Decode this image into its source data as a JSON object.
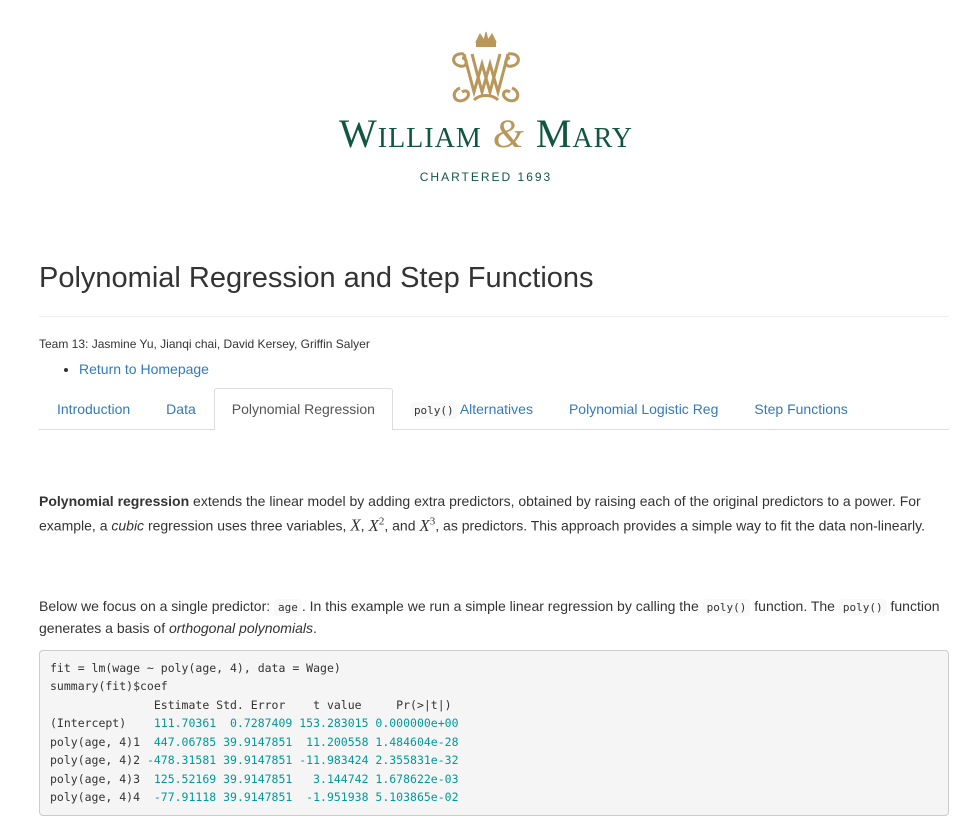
{
  "logo": {
    "name_left": "William",
    "ampersand": "&",
    "name_right": "Mary",
    "tagline": "CHARTERED 1693"
  },
  "page": {
    "title": "Polynomial Regression and Step Functions",
    "authors": "Team 13: Jasmine Yu, Jianqi chai, David Kersey, Griffin Salyer",
    "links": [
      "Return to Homepage"
    ]
  },
  "tabs": {
    "introduction": "Introduction",
    "data": "Data",
    "polynomial_regression": "Polynomial Regression",
    "poly_code": "poly()",
    "poly_alternatives": "Alternatives",
    "polynomial_logistic": "Polynomial Logistic Reg",
    "step_functions": "Step Functions"
  },
  "paragraph1": {
    "bold": "Polynomial regression",
    "t1": " extends the linear model by adding extra predictors, obtained by raising each of the original predictors to a power. For example, a ",
    "em": "cubic",
    "t2": " regression uses three variables, ",
    "m1": "X",
    "sep1": ", ",
    "m2": "X",
    "m2sup": "2",
    "sep2": ", and ",
    "m3": "X",
    "m3sup": "3",
    "t3": ", as predictors. This approach provides a simple way to fit the data non-linearly."
  },
  "paragraph2": {
    "t1": "Below we focus on a single predictor: ",
    "c1": "age",
    "t2": ". In this example we run a simple linear regression by calling the ",
    "c2": "poly()",
    "t3": " function. The ",
    "c3": "poly()",
    "t4": " function generates a basis of ",
    "em": "orthogonal polynomials",
    "t5": "."
  },
  "code": {
    "lines": [
      "fit = lm(wage ~ poly(age, 4), data = Wage)",
      "summary(fit)$coef"
    ],
    "output_header": "               Estimate Std. Error    t value     Pr(>|t|)",
    "output_rows": [
      {
        "label": "(Intercept)    ",
        "values": "111.70361  0.7287409 153.283015 0.000000e+00"
      },
      {
        "label": "poly(age, 4)1  ",
        "values": "447.06785 39.9147851  11.200558 1.484604e-28"
      },
      {
        "label": "poly(age, 4)2 ",
        "values": "-478.31581 39.9147851 -11.983424 2.355831e-32"
      },
      {
        "label": "poly(age, 4)3  ",
        "values": "125.52169 39.9147851   3.144742 1.678622e-03"
      },
      {
        "label": "poly(age, 4)4  ",
        "values": "-77.91118 39.9147851  -1.951938 5.103865e-02"
      }
    ]
  },
  "colors": {
    "brand_green": "#115740",
    "brand_gold": "#b9975b",
    "link_blue": "#337ab7",
    "number_teal": "#009999"
  }
}
